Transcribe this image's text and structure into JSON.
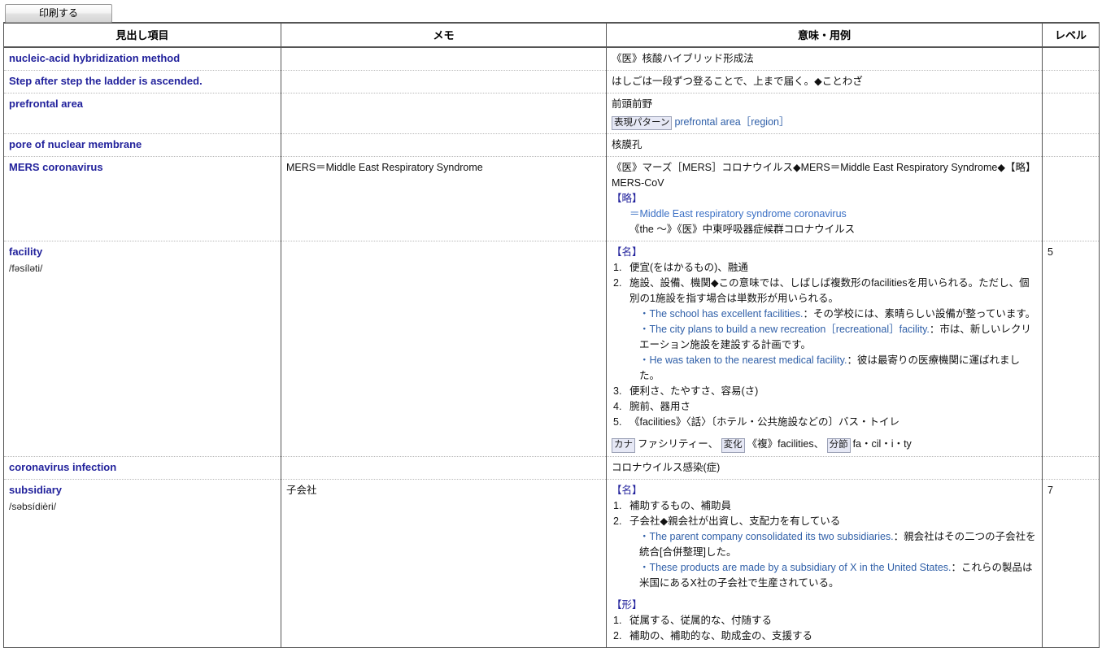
{
  "toolbar": {
    "print_label": "印刷する"
  },
  "table": {
    "headers": {
      "headword": "見出し項目",
      "memo": "メモ",
      "meaning": "意味・用例",
      "level": "レベル"
    },
    "rows": [
      {
        "headword": "nucleic-acid hybridization method",
        "phonetic": "",
        "memo": "",
        "level": "",
        "meaning_lines": [
          "《医》核酸ハイブリッド形成法"
        ]
      },
      {
        "headword": "Step after step the ladder is ascended.",
        "phonetic": "",
        "memo": "",
        "level": "",
        "meaning_lines": [
          "はしごは一段ずつ登ることで、上まで届く。◆ことわざ"
        ]
      },
      {
        "headword": "prefrontal area",
        "phonetic": "",
        "memo": "",
        "level": "",
        "meaning_lines": [
          "前頭前野"
        ],
        "pattern_tag": "表現パターン",
        "pattern_text": "prefrontal area［region］"
      },
      {
        "headword": "pore of nuclear membrane",
        "phonetic": "",
        "memo": "",
        "level": "",
        "meaning_lines": [
          "核膜孔"
        ]
      },
      {
        "headword": "MERS coronavirus",
        "phonetic": "",
        "memo": "MERS＝Middle East Respiratory Syndrome",
        "level": "",
        "mers": {
          "line1": "《医》マーズ［MERS］コロナウイルス◆MERS＝Middle East Respiratory Syndrome◆【略】MERS-CoV",
          "abbr_label": "【略】",
          "abbr_link": "＝Middle East respiratory syndrome coronavirus",
          "abbr_gloss": "《the ～》《医》中東呼吸器症候群コロナウイルス"
        }
      },
      {
        "headword": "facility",
        "phonetic": "/fəsíləti/",
        "memo": "",
        "level": "5",
        "facility": {
          "pos": "【名】",
          "items": [
            {
              "num": "1.",
              "text": "便宜(をはかるもの)、融通"
            },
            {
              "num": "2.",
              "text": "施設、設備、機関◆この意味では、しばしば複数形のfacilitiesを用いられる。ただし、個別の1施設を指す場合は単数形が用いられる。"
            },
            {
              "num": "3.",
              "text": "便利さ、たやすさ、容易(さ)"
            },
            {
              "num": "4.",
              "text": "腕前、器用さ"
            },
            {
              "num": "5.",
              "text": "《facilities》〈話〉〔ホテル・公共施設などの〕バス・トイレ"
            }
          ],
          "examples": [
            {
              "en": "・The school has excellent facilities.",
              "ja": "：その学校には、素晴らしい設備が整っています。"
            },
            {
              "en": "・The city plans to build a new recreation［recreational］facility.",
              "ja": "：市は、新しいレクリエーション施設を建設する計画です。"
            },
            {
              "en": "・He was taken to the nearest medical facility.",
              "ja": "：彼は最寄りの医療機関に運ばれました。"
            }
          ],
          "tags": [
            {
              "label": "カナ",
              "value": "ファシリティー、"
            },
            {
              "label": "変化",
              "value": "《複》facilities、"
            },
            {
              "label": "分節",
              "value": "fa・cil・i・ty"
            }
          ]
        }
      },
      {
        "headword": "coronavirus infection",
        "phonetic": "",
        "memo": "",
        "level": "",
        "meaning_lines": [
          "コロナウイルス感染(症)"
        ]
      },
      {
        "headword": "subsidiary",
        "phonetic": "/səbsídièri/",
        "memo": "子会社",
        "level": "7",
        "subsidiary": {
          "pos_noun": "【名】",
          "noun_items": [
            {
              "num": "1.",
              "text": "補助するもの、補助員"
            },
            {
              "num": "2.",
              "text": "子会社◆親会社が出資し、支配力を有している"
            }
          ],
          "examples": [
            {
              "en": "・The parent company consolidated its two subsidiaries.",
              "ja": "：親会社はその二つの子会社を統合[合併整理]した。"
            },
            {
              "en": "・These products are made by a subsidiary of X in the United States.",
              "ja": "：これらの製品は米国にあるX社の子会社で生産されている。"
            }
          ],
          "pos_adj": "【形】",
          "adj_items": [
            {
              "num": "1.",
              "text": "従属する、従属的な、付随する"
            },
            {
              "num": "2.",
              "text": "補助の、補助的な、助成金の、支援する"
            }
          ]
        }
      }
    ]
  }
}
